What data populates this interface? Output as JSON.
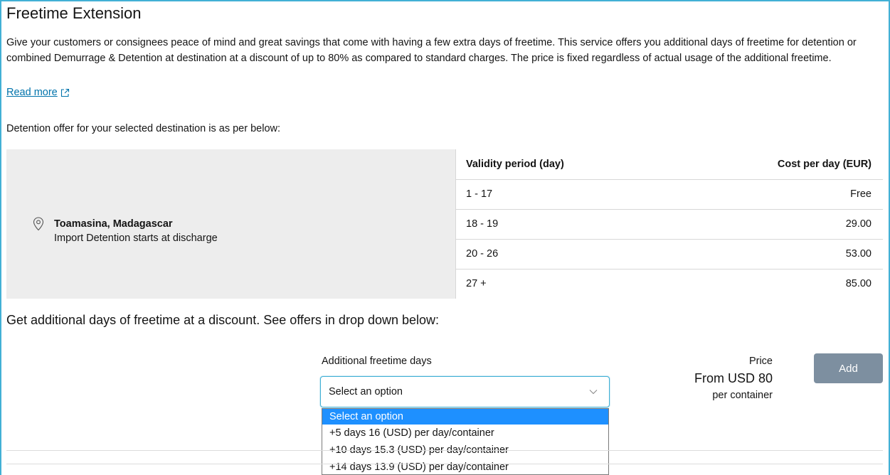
{
  "section": {
    "title": "Freetime Extension",
    "intro": "Give your customers or consignees peace of mind and great savings that come with having a few extra days of freetime. This service offers you additional days of freetime for detention or combined Demurrage & Detention at destination at a discount of up to 80% as compared to standard charges. The price is fixed regardless of actual usage of the additional freetime.",
    "read_more": "Read more",
    "offer_label": "Detention offer for your selected destination is as per below:"
  },
  "location": {
    "name": "Toamasina, Madagascar",
    "subtitle": "Import Detention starts at discharge",
    "icon": "map-pin-icon"
  },
  "rate_table": {
    "headers": [
      "Validity period (day)",
      "Cost per day (EUR)"
    ],
    "rows": [
      {
        "period": "1 - 17",
        "cost": "Free"
      },
      {
        "period": "18 - 19",
        "cost": "29.00"
      },
      {
        "period": "20 - 26",
        "cost": "53.00"
      },
      {
        "period": "27 +",
        "cost": "85.00"
      }
    ]
  },
  "discount": {
    "heading": "Get additional days of freetime at a discount. See offers in drop down below:",
    "field_label": "Additional freetime days",
    "selected_value": "Select an option",
    "options": [
      "Select an option",
      "+5 days 16 (USD) per day/container",
      "+10 days 15.3 (USD) per day/container",
      "+14 days 13.9 (USD) per day/container"
    ]
  },
  "price": {
    "label": "Price",
    "value": "From USD 80",
    "unit": "per container"
  },
  "actions": {
    "add_label": "Add"
  },
  "colors": {
    "accent_border": "#42b0d5",
    "link": "#0073ab",
    "selected_option": "#1e90ff",
    "add_button": "#7d8fa0",
    "panel_grey": "#ededed"
  }
}
